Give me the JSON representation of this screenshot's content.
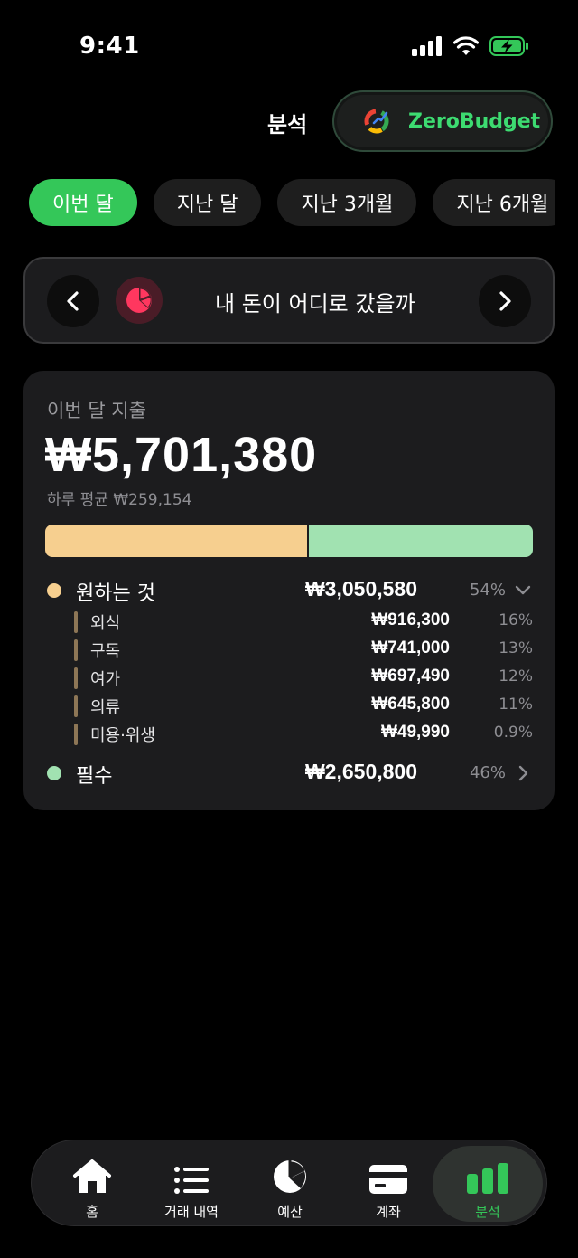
{
  "status_bar": {
    "time": "9:41"
  },
  "header": {
    "title": "분석",
    "brand_name": "ZeroBudget"
  },
  "period_tabs": [
    {
      "label": "이번 달",
      "active": true
    },
    {
      "label": "지난 달",
      "active": false
    },
    {
      "label": "지난 3개월",
      "active": false
    },
    {
      "label": "지난 6개월",
      "active": false
    }
  ],
  "report": {
    "title": "내 돈이 어디로 갔을까"
  },
  "spending": {
    "label": "이번 달 지출",
    "total": "₩5,701,380",
    "daily_average": "하루 평균 ₩259,154",
    "wants_share": 0.54,
    "categories": [
      {
        "name": "원하는 것",
        "amount": "₩3,050,580",
        "percent": "54%",
        "color": "#f6cf8f",
        "expanded": true,
        "subcategories": [
          {
            "name": "외식",
            "amount": "₩916,300",
            "percent": "16%"
          },
          {
            "name": "구독",
            "amount": "₩741,000",
            "percent": "13%"
          },
          {
            "name": "여가",
            "amount": "₩697,490",
            "percent": "12%"
          },
          {
            "name": "의류",
            "amount": "₩645,800",
            "percent": "11%"
          },
          {
            "name": "미용·위생",
            "amount": "₩49,990",
            "percent": "0.9%"
          }
        ]
      },
      {
        "name": "필수",
        "amount": "₩2,650,800",
        "percent": "46%",
        "color": "#a1e2b1",
        "expanded": false
      }
    ]
  },
  "tab_bar": [
    {
      "label": "홈",
      "icon": "home-icon",
      "active": false
    },
    {
      "label": "거래 내역",
      "icon": "list-icon",
      "active": false
    },
    {
      "label": "예산",
      "icon": "pie-chart-icon",
      "active": false
    },
    {
      "label": "계좌",
      "icon": "card-icon",
      "active": false
    },
    {
      "label": "분석",
      "icon": "bar-chart-icon",
      "active": true
    }
  ],
  "colors": {
    "accent": "#34c759",
    "brand": "#3ddb71",
    "report_icon": "#ff375f",
    "wants": "#f6cf8f",
    "needs": "#a1e2b1"
  }
}
